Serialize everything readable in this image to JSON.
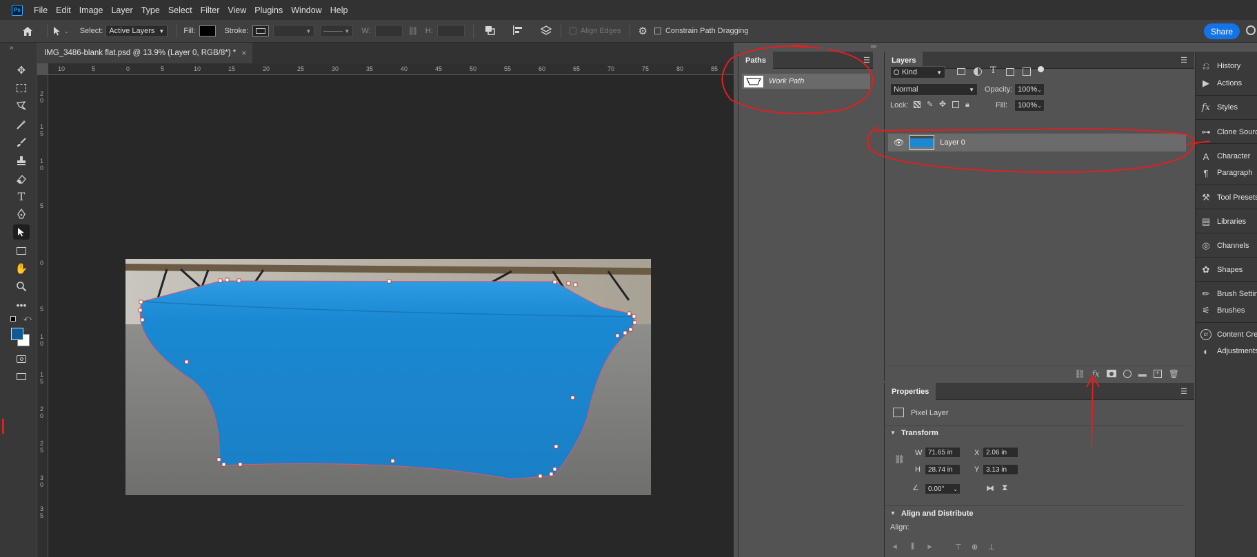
{
  "menu": [
    "File",
    "Edit",
    "Image",
    "Layer",
    "Type",
    "Select",
    "Filter",
    "View",
    "Plugins",
    "Window",
    "Help"
  ],
  "app_logo": "Ps",
  "options": {
    "select_label": "Select:",
    "select_value": "Active Layers",
    "fill_label": "Fill:",
    "stroke_label": "Stroke:",
    "w_label": "W:",
    "h_label": "H:",
    "align_edges": "Align Edges",
    "constrain_label": "Constrain Path Dragging",
    "share_label": "Share"
  },
  "document_tab": {
    "title": "IMG_3486-blank flat.psd @ 13.9% (Layer 0, RGB/8*) *",
    "close": "×"
  },
  "ruler_h": [
    "10",
    "5",
    "0",
    "5",
    "10",
    "15",
    "20",
    "25",
    "30",
    "35",
    "40",
    "45",
    "50",
    "55",
    "60",
    "65",
    "70",
    "75",
    "80",
    "85"
  ],
  "ruler_v": [
    "2",
    "0",
    "1",
    "5",
    "1",
    "0",
    "5",
    "0",
    "5",
    "1",
    "0",
    "1",
    "5",
    "2",
    "0",
    "2",
    "5",
    "3",
    "0",
    "3",
    "5"
  ],
  "paths_panel": {
    "tab": "Paths",
    "work_path": "Work Path"
  },
  "layers_panel": {
    "tab": "Layers",
    "kind": "Kind",
    "blend_mode": "Normal",
    "opacity_label": "Opacity:",
    "opacity_value": "100%",
    "lock_label": "Lock:",
    "fill_label": "Fill:",
    "fill_value": "100%",
    "layer_name": "Layer 0"
  },
  "properties_panel": {
    "tab": "Properties",
    "kind": "Pixel Layer",
    "transform_label": "Transform",
    "w_label": "W",
    "w_value": "71.65 in",
    "h_label": "H",
    "h_value": "28.74 in",
    "x_label": "X",
    "x_value": "2.06 in",
    "y_label": "Y",
    "y_value": "3.13 in",
    "angle_value": "0.00°",
    "align_section": "Align and Distribute",
    "align_label": "Align:"
  },
  "dock": [
    "History",
    "Actions",
    "Styles",
    "Clone Source",
    "Character",
    "Paragraph",
    "Tool Presets",
    "Libraries",
    "Channels",
    "Shapes",
    "Brush Settings",
    "Brushes",
    "Content Credentials",
    "Adjustments"
  ],
  "colors": {
    "foreground": "#0d5a94",
    "annotation": "#e02020",
    "cloth": "#1a8ad4",
    "share": "#1473e6"
  }
}
